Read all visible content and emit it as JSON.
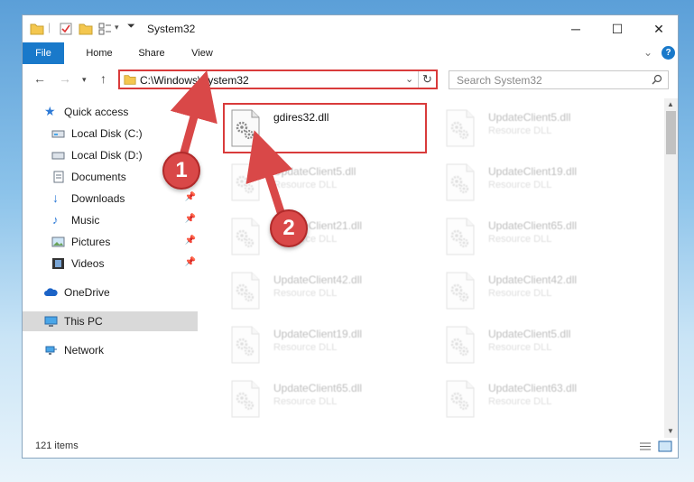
{
  "window": {
    "title": "System32",
    "minimize_glyph": "─",
    "maximize_glyph": "☐",
    "close_glyph": "✕"
  },
  "ribbon": {
    "tabs": [
      "File",
      "Home",
      "Share",
      "View"
    ],
    "expand_glyph": "⌄",
    "help_glyph": "?"
  },
  "address": {
    "path": "C:\\Windows\\System32",
    "search_placeholder": "Search System32"
  },
  "nav": [
    {
      "label": "Quick access",
      "icon": "star-icon",
      "pinned": false
    },
    {
      "label": "Local Disk (C:)",
      "icon": "drive-icon",
      "pinned": false
    },
    {
      "label": "Local Disk (D:)",
      "icon": "drive-icon",
      "pinned": false
    },
    {
      "label": "Documents",
      "icon": "documents-icon",
      "pinned": false
    },
    {
      "label": "Downloads",
      "icon": "download-icon",
      "pinned": true
    },
    {
      "label": "Music",
      "icon": "music-icon",
      "pinned": true
    },
    {
      "label": "Pictures",
      "icon": "pictures-icon",
      "pinned": true
    },
    {
      "label": "Videos",
      "icon": "videos-icon",
      "pinned": true
    },
    {
      "label": "OneDrive",
      "icon": "cloud-icon",
      "pinned": false
    },
    {
      "label": "This PC",
      "icon": "computer-icon",
      "pinned": false,
      "selected": true
    },
    {
      "label": "Network",
      "icon": "network-icon",
      "pinned": false
    }
  ],
  "files": [
    {
      "name": "gdires32.dll",
      "type": "",
      "highlighted": true
    },
    {
      "name": "UpdateClient5.dll",
      "type": "Resource DLL"
    },
    {
      "name": "UpdateClient5.dll",
      "type": "Resource DLL"
    },
    {
      "name": "UpdateClient19.dll",
      "type": "Resource DLL"
    },
    {
      "name": "UpdateClient21.dll",
      "type": "Resource DLL"
    },
    {
      "name": "UpdateClient65.dll",
      "type": "Resource DLL"
    },
    {
      "name": "UpdateClient42.dll",
      "type": "Resource DLL"
    },
    {
      "name": "UpdateClient42.dll",
      "type": "Resource DLL"
    },
    {
      "name": "UpdateClient19.dll",
      "type": "Resource DLL"
    },
    {
      "name": "UpdateClient5.dll",
      "type": "Resource DLL"
    },
    {
      "name": "UpdateClient65.dll",
      "type": "Resource DLL"
    },
    {
      "name": "UpdateClient63.dll",
      "type": "Resource DLL"
    }
  ],
  "status": {
    "item_count": "121 items"
  },
  "callouts": [
    "1",
    "2"
  ],
  "colors": {
    "accent": "#1979ca",
    "callout": "#d94848",
    "highlight_border": "#d93b3b"
  }
}
